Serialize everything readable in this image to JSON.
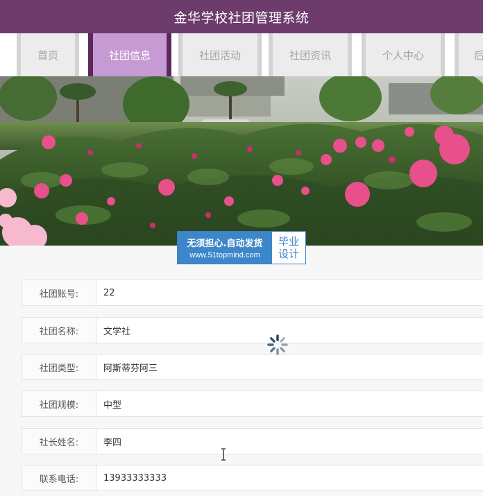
{
  "header": {
    "title": "金华学校社团管理系统"
  },
  "nav": {
    "items": [
      {
        "label": "首页"
      },
      {
        "label": "社团信息"
      },
      {
        "label": "社团活动"
      },
      {
        "label": "社团资讯"
      },
      {
        "label": "个人中心"
      },
      {
        "label": "后"
      }
    ],
    "active_index": 1
  },
  "banner": {
    "icon": "peony-garden-photo"
  },
  "watermark": {
    "line1": "无须担心.自动发货",
    "line2": "www.51topmind.com",
    "tag_line1": "毕业",
    "tag_line2": "设计"
  },
  "form": {
    "fields": [
      {
        "label": "社团账号:",
        "value": "22"
      },
      {
        "label": "社团名称:",
        "value": "文学社"
      },
      {
        "label": "社团类型:",
        "value": "阿斯蒂芬阿三"
      },
      {
        "label": "社团规模:",
        "value": "中型"
      },
      {
        "label": "社长姓名:",
        "value": "李四"
      },
      {
        "label": "联系电话:",
        "value": "13933333333"
      }
    ]
  },
  "colors": {
    "header_bg": "#6d3c6d",
    "nav_active_bg": "#c69bd4",
    "nav_active_border": "#5b2a5b",
    "watermark_blue": "#3d86c9"
  },
  "icons": {
    "spinner": "loading-spinner-icon",
    "cursor": "text-cursor-icon"
  }
}
